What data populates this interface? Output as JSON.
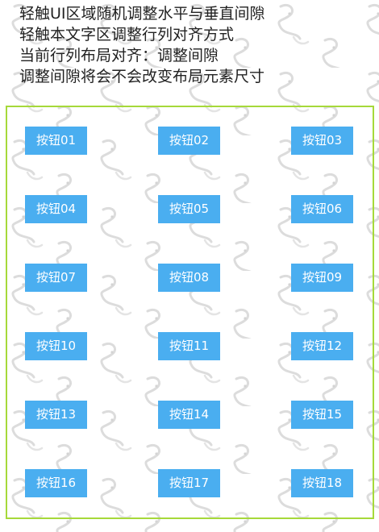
{
  "instructions": [
    "轻触UI区域随机调整水平与垂直间隙",
    "轻触本文字区调整行列对齐方式",
    "当前行列布局对齐：调整间隙",
    "调整间隙将会不会改变布局元素尺寸"
  ],
  "buttons": [
    "按钮01",
    "按钮02",
    "按钮03",
    "按钮04",
    "按钮05",
    "按钮06",
    "按钮07",
    "按钮08",
    "按钮09",
    "按钮10",
    "按钮11",
    "按钮12",
    "按钮13",
    "按钮14",
    "按钮15",
    "按钮16",
    "按钮17",
    "按钮18"
  ],
  "colors": {
    "button_bg": "#4aaef0",
    "button_text": "#ffffff",
    "border": "#a6d93a"
  }
}
